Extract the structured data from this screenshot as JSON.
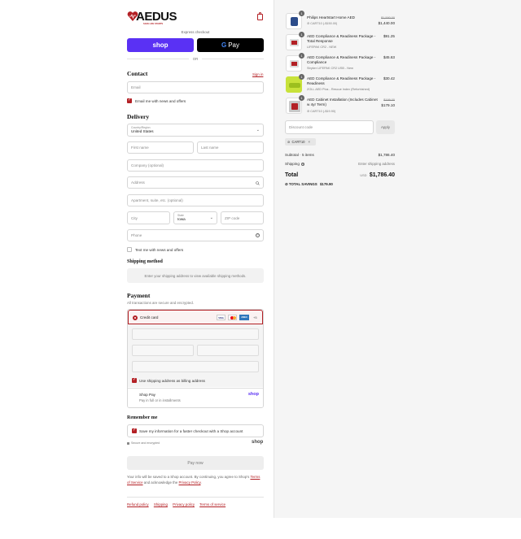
{
  "brand": {
    "name": "AEDUS",
    "tagline": "SAFE LIFE STARTS"
  },
  "express": {
    "label": "Express checkout",
    "shop_pay": "shop",
    "gpay": "Pay",
    "or": "OR"
  },
  "contact": {
    "title": "Contact",
    "sign_in": "Sign in",
    "email_placeholder": "Email",
    "news_label": "Email me with news and offers"
  },
  "delivery": {
    "title": "Delivery",
    "country_label": "Country/Region",
    "country_value": "United States",
    "first_name": "First name",
    "last_name": "Last name",
    "company": "Company (optional)",
    "address": "Address",
    "apartment": "Apartment, suite, etc. (optional)",
    "city": "City",
    "state_label": "State",
    "state_value": "Iowa",
    "zip": "ZIP code",
    "phone": "Phone",
    "text_label": "Text me with news and offers"
  },
  "shipping": {
    "title": "Shipping method",
    "message": "Enter your shipping address to view available shipping methods."
  },
  "payment": {
    "title": "Payment",
    "subtitle": "All transactions are secure and encrypted.",
    "credit_card": "Credit card",
    "more_cards": "+5",
    "cards": [
      "VISA",
      "MC",
      "AMEX"
    ],
    "billing_label": "Use shipping address as billing address",
    "shop_pay_title": "Shop Pay",
    "shop_pay_sub": "Pay in full or in installments",
    "shop_logo": "shop"
  },
  "remember": {
    "title": "Remember me",
    "save_label": "Save my information for a faster checkout with a Shop account",
    "secure": "Secure and encrypted",
    "shop_logo": "shop"
  },
  "pay_now": "Pay now",
  "legal": {
    "text1": "Your info will be saved to a Shop account. By continuing, you agree to Shop's",
    "tos": "Terms of Service",
    "text2": "and acknowledge the",
    "privacy": "Privacy Policy",
    "period": "."
  },
  "footer": {
    "links": [
      "Refund policy",
      "Shipping",
      "Privacy policy",
      "Terms of service"
    ]
  },
  "cart": {
    "items": [
      {
        "qty": "1",
        "name": "Philips Heartstart Home AED",
        "sub": "CART10 (-$150.00)",
        "old": "$1,590.00",
        "price": "$1,440.00"
      },
      {
        "qty": "1",
        "name": "AED Compliance & Readiness Package - Total Response",
        "sub": "LIFEPAK CR2 - NEW",
        "old": "",
        "price": "$91.25"
      },
      {
        "qty": "1",
        "name": "AED Compliance & Readiness Package - Compliance",
        "sub": "Stryker LIFEPAK CR2 USB - New",
        "old": "",
        "price": "$45.63"
      },
      {
        "qty": "1",
        "name": "AED Compliance & Readiness Package - Readiness",
        "sub": "ZOLL AED Plus - Rescue Index (Refurbished)",
        "old": "",
        "price": "$30.42"
      },
      {
        "qty": "1",
        "name": "AED Cabinet Installation (Includes Cabinet w 4yr Term)",
        "sub": "CART10 (-$19.90)",
        "old": "$199.00",
        "price": "$179.10"
      }
    ],
    "discount_placeholder": "Discount code",
    "apply": "Apply",
    "tag": "CART10",
    "subtotal_label": "Subtotal · 5 items",
    "subtotal": "$1,786.40",
    "shipping_label": "Shipping",
    "shipping_value": "Enter shipping address",
    "total_label": "Total",
    "currency": "USD",
    "total": "$1,786.40",
    "savings_label": "TOTAL SAVINGS",
    "savings": "$179.90"
  },
  "colors": {
    "brand_red": "#b32025",
    "shop_purple": "#5a31f4",
    "gpay_black": "#000000"
  }
}
